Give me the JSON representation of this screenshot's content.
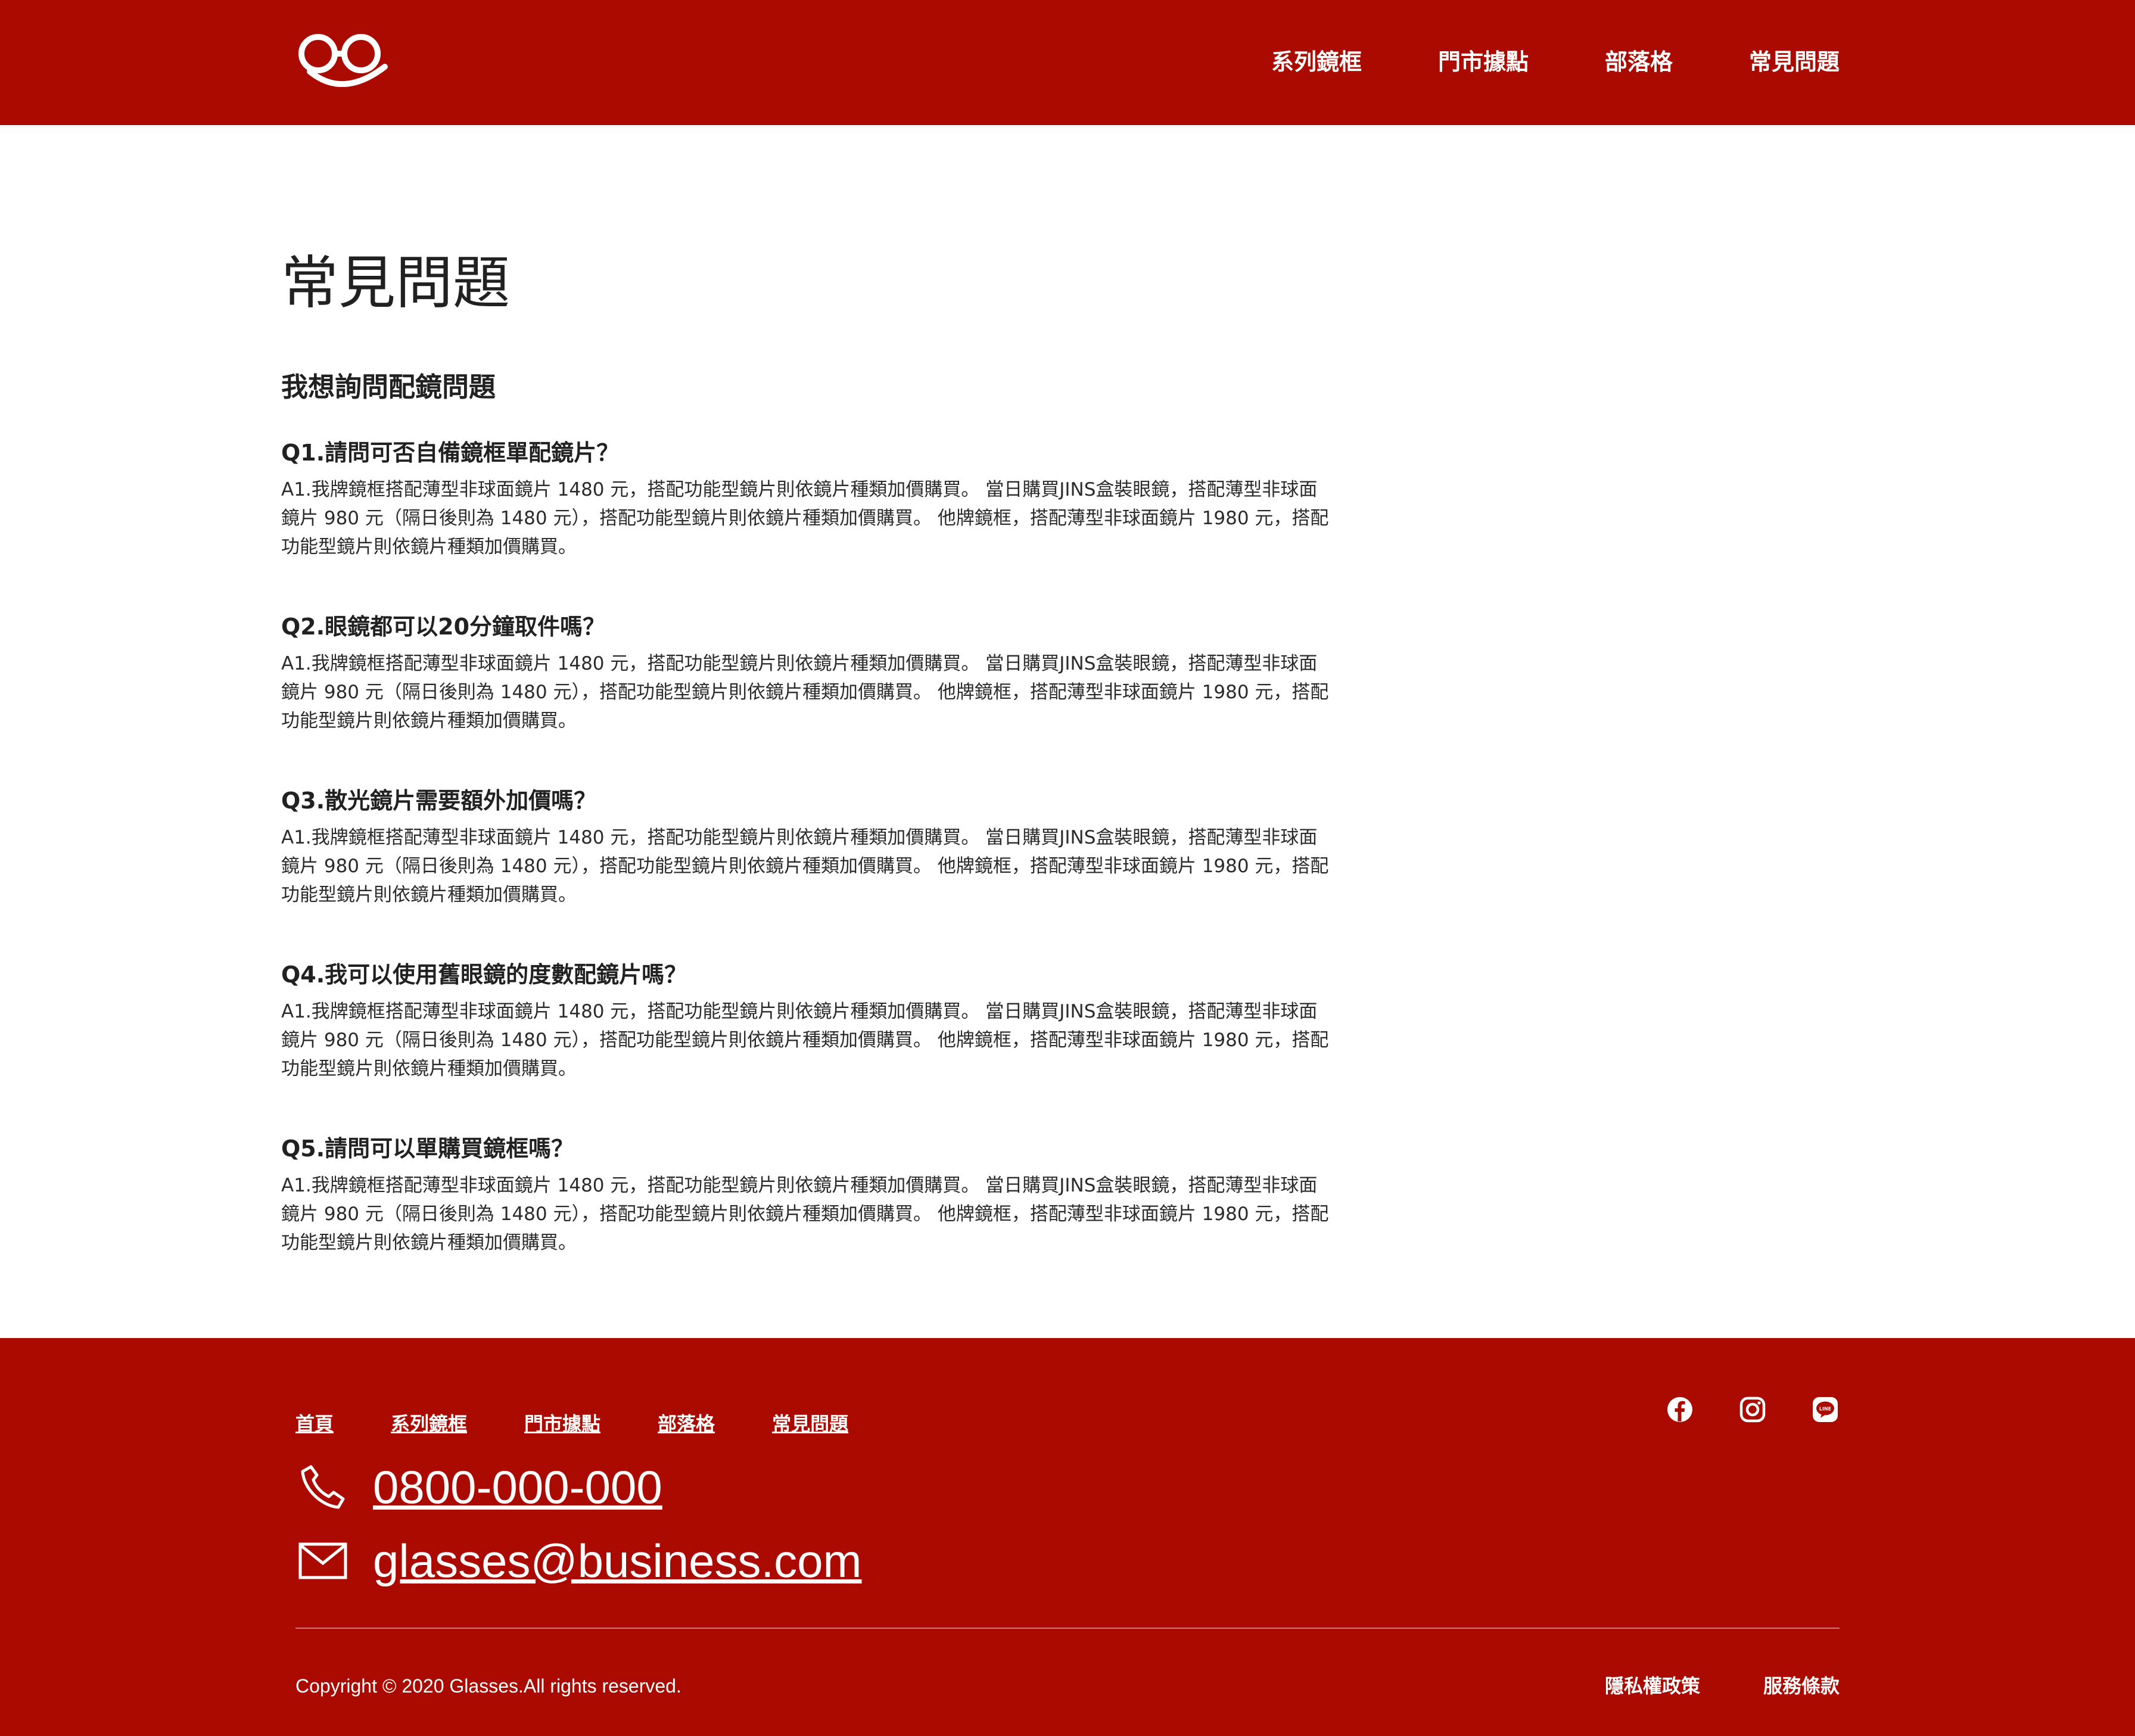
{
  "header": {
    "logo_name": "glasses-logo",
    "nav": [
      {
        "label": "系列鏡框"
      },
      {
        "label": "門市據點"
      },
      {
        "label": "部落格"
      },
      {
        "label": "常見問題"
      }
    ]
  },
  "main": {
    "title": "常見問題",
    "section_title": "我想詢問配鏡問題",
    "faqs": [
      {
        "question": "Q1.請問可否自備鏡框單配鏡片？",
        "answer": "A1.我牌鏡框搭配薄型非球面鏡片 1480 元，搭配功能型鏡片則依鏡片種類加價購買。 當日購買JINS盒裝眼鏡，搭配薄型非球面鏡片 980 元（隔日後則為 1480 元），搭配功能型鏡片則依鏡片種類加價購買。 他牌鏡框，搭配薄型非球面鏡片 1980 元，搭配功能型鏡片則依鏡片種類加價購買。"
      },
      {
        "question": "Q2.眼鏡都可以20分鐘取件嗎？",
        "answer": "A1.我牌鏡框搭配薄型非球面鏡片 1480 元，搭配功能型鏡片則依鏡片種類加價購買。 當日購買JINS盒裝眼鏡，搭配薄型非球面鏡片 980 元（隔日後則為 1480 元），搭配功能型鏡片則依鏡片種類加價購買。 他牌鏡框，搭配薄型非球面鏡片 1980 元，搭配功能型鏡片則依鏡片種類加價購買。"
      },
      {
        "question": "Q3.散光鏡片需要額外加價嗎？",
        "answer": "A1.我牌鏡框搭配薄型非球面鏡片 1480 元，搭配功能型鏡片則依鏡片種類加價購買。 當日購買JINS盒裝眼鏡，搭配薄型非球面鏡片 980 元（隔日後則為 1480 元），搭配功能型鏡片則依鏡片種類加價購買。 他牌鏡框，搭配薄型非球面鏡片 1980 元，搭配功能型鏡片則依鏡片種類加價購買。"
      },
      {
        "question": "Q4.我可以使用舊眼鏡的度數配鏡片嗎？",
        "answer": "A1.我牌鏡框搭配薄型非球面鏡片 1480 元，搭配功能型鏡片則依鏡片種類加價購買。 當日購買JINS盒裝眼鏡，搭配薄型非球面鏡片 980 元（隔日後則為 1480 元），搭配功能型鏡片則依鏡片種類加價購買。 他牌鏡框，搭配薄型非球面鏡片 1980 元，搭配功能型鏡片則依鏡片種類加價購買。"
      },
      {
        "question": "Q5.請問可以單購買鏡框嗎？",
        "answer": "A1.我牌鏡框搭配薄型非球面鏡片 1480 元，搭配功能型鏡片則依鏡片種類加價購買。 當日購買JINS盒裝眼鏡，搭配薄型非球面鏡片 980 元（隔日後則為 1480 元），搭配功能型鏡片則依鏡片種類加價購買。 他牌鏡框，搭配薄型非球面鏡片 1980 元，搭配功能型鏡片則依鏡片種類加價購買。"
      }
    ]
  },
  "footer": {
    "nav": [
      {
        "label": "首頁"
      },
      {
        "label": "系列鏡框"
      },
      {
        "label": "門市據點"
      },
      {
        "label": "部落格"
      },
      {
        "label": "常見問題"
      }
    ],
    "social": [
      "facebook-icon",
      "instagram-icon",
      "line-icon"
    ],
    "phone": "0800-000-000",
    "email": "glasses@business.com",
    "copyright": "Copyright © 2020 Glasses.All rights reserved.",
    "legal": [
      {
        "label": "隱私權政策"
      },
      {
        "label": "服務條款"
      }
    ]
  },
  "colors": {
    "brand_red": "#ab0a00",
    "text": "#212121",
    "background": "#ffffff"
  }
}
